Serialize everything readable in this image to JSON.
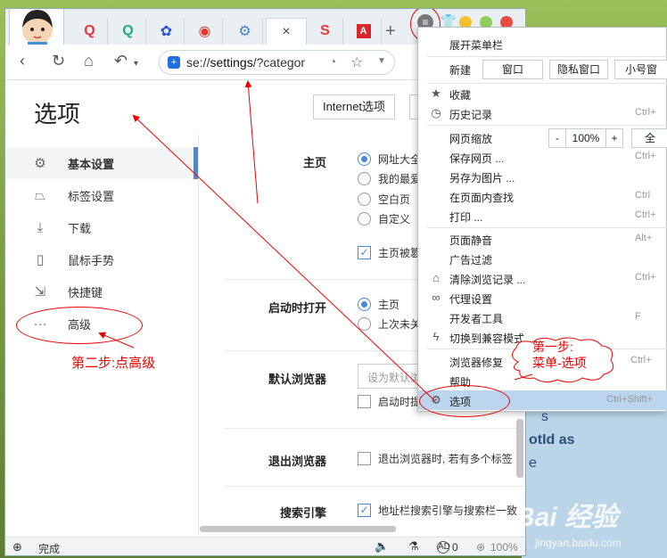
{
  "browser": {
    "url_prefix": "se://",
    "url_main": "settings",
    "url_suffix": "/?categor",
    "page_title": "选项",
    "internet_options": "Internet选项",
    "tab_close": "×",
    "tab_add": "+"
  },
  "sidebar": {
    "items": [
      {
        "label": "基本设置",
        "icon": "gear-icon"
      },
      {
        "label": "标签设置",
        "icon": "tab-icon"
      },
      {
        "label": "下载",
        "icon": "download-icon"
      },
      {
        "label": "鼠标手势",
        "icon": "mouse-icon"
      },
      {
        "label": "快捷键",
        "icon": "shortcut-icon"
      },
      {
        "label": "高级",
        "icon": "more-icon"
      }
    ]
  },
  "settings": {
    "homepage": {
      "label": "主页",
      "options": [
        "网址大全",
        "我的最爱",
        "空白页",
        "自定义"
      ],
      "selected": 0,
      "checkbox": "主页被篡"
    },
    "startup": {
      "label": "启动时打开",
      "options": [
        "主页",
        "上次未关"
      ],
      "selected": 0
    },
    "default_browser": {
      "label": "默认浏览器",
      "input": "设为默认浏",
      "checkbox": "启动时提"
    },
    "exit": {
      "label": "退出浏览器",
      "checkbox": "退出浏览器时, 若有多个标签"
    },
    "search": {
      "label": "搜索引擎",
      "checkbox": "地址栏搜索引擎与搜索栏一致"
    }
  },
  "statusbar": {
    "status": "完成",
    "ad_count": "0",
    "zoom": "100%"
  },
  "menu": {
    "expand": "展开菜单栏",
    "new_label": "新建",
    "new_buttons": [
      "窗口",
      "隐私窗口",
      "小号窗"
    ],
    "items1": [
      {
        "label": "收藏",
        "icon": "star-icon",
        "shortcut": ""
      },
      {
        "label": "历史记录",
        "icon": "clock-icon",
        "shortcut": "Ctrl+"
      }
    ],
    "zoom_label": "网页缩放",
    "zoom_minus": "-",
    "zoom_value": "100%",
    "zoom_plus": "+",
    "zoom_full": "全",
    "items2": [
      {
        "label": "保存网页 ...",
        "shortcut": "Ctrl+"
      },
      {
        "label": "另存为图片 ...",
        "shortcut": ""
      },
      {
        "label": "在页面内查找",
        "shortcut": "Ctrl"
      },
      {
        "label": "打印 ...",
        "shortcut": "Ctrl+"
      }
    ],
    "items3": [
      {
        "label": "页面静音",
        "icon": "",
        "shortcut": "Alt+"
      },
      {
        "label": "广告过滤",
        "icon": "",
        "shortcut": ""
      },
      {
        "label": "清除浏览记录 ...",
        "icon": "broom-icon",
        "shortcut": "Ctrl+"
      },
      {
        "label": "代理设置",
        "icon": "link-icon",
        "shortcut": ""
      },
      {
        "label": "开发者工具",
        "icon": "",
        "shortcut": "F"
      },
      {
        "label": "切换到兼容模式",
        "icon": "lightning-icon",
        "shortcut": ""
      }
    ],
    "items4": [
      {
        "label": "浏览器修复",
        "shortcut": "Ctrl+"
      },
      {
        "label": "帮助",
        "shortcut": ""
      },
      {
        "label": "选项",
        "shortcut": "Ctrl+Shift+"
      }
    ]
  },
  "annotations": {
    "step1": "第一步:",
    "step1b": "菜单-选项",
    "step2": "第二步:点高级"
  },
  "background": {
    "text1": "s",
    "text2": "otId as",
    "text3": "e",
    "watermark": "Bai 经验",
    "watermark_sub": "jingyan.baidu.com"
  },
  "colors": {
    "accent": "#4b89d6",
    "annotation": "#e00000",
    "menu_highlight": "#bcd5ee"
  }
}
